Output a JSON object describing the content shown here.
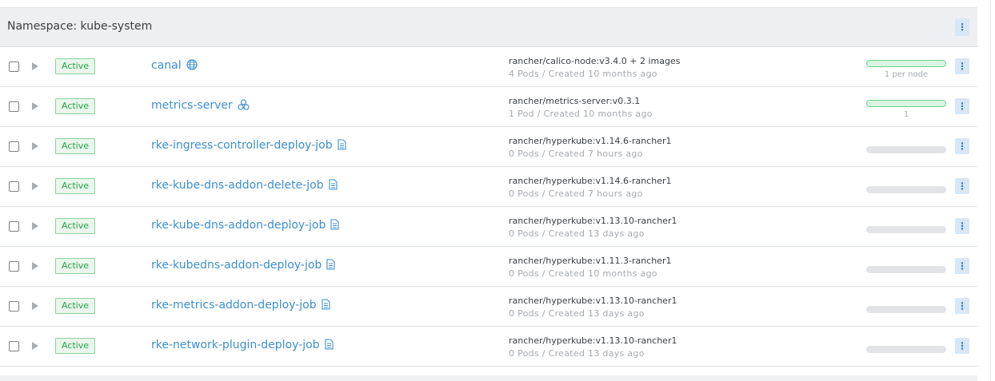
{
  "namespace": {
    "label": "Namespace: kube-system"
  },
  "colors": {
    "active_green": "#29a34a",
    "link_blue": "#3d8fd1",
    "kebab_bg": "#d8e7f6"
  },
  "rows": [
    {
      "state": "Active",
      "name": "canal",
      "icon": "globe-icon",
      "image": "rancher/calico-node:v3.4.0 + 2 images",
      "pods": "4 Pods",
      "created": "Created 10 months ago",
      "scale_type": "green",
      "scale_label": "1 per node"
    },
    {
      "state": "Active",
      "name": "metrics-server",
      "icon": "deployment-icon",
      "image": "rancher/metrics-server:v0.3.1",
      "pods": "1 Pod",
      "created": "Created 10 months ago",
      "scale_type": "green",
      "scale_label": "1"
    },
    {
      "state": "Active",
      "name": "rke-ingress-controller-deploy-job",
      "icon": "job-icon",
      "image": "rancher/hyperkube:v1.14.6-rancher1",
      "pods": "0 Pods",
      "created": "Created 7 hours ago",
      "scale_type": "grey",
      "scale_label": ""
    },
    {
      "state": "Active",
      "name": "rke-kube-dns-addon-delete-job",
      "icon": "job-icon",
      "image": "rancher/hyperkube:v1.14.6-rancher1",
      "pods": "0 Pods",
      "created": "Created 7 hours ago",
      "scale_type": "grey",
      "scale_label": ""
    },
    {
      "state": "Active",
      "name": "rke-kube-dns-addon-deploy-job",
      "icon": "job-icon",
      "image": "rancher/hyperkube:v1.13.10-rancher1",
      "pods": "0 Pods",
      "created": "Created 13 days ago",
      "scale_type": "grey",
      "scale_label": ""
    },
    {
      "state": "Active",
      "name": "rke-kubedns-addon-deploy-job",
      "icon": "job-icon",
      "image": "rancher/hyperkube:v1.11.3-rancher1",
      "pods": "0 Pods",
      "created": "Created 10 months ago",
      "scale_type": "grey",
      "scale_label": ""
    },
    {
      "state": "Active",
      "name": "rke-metrics-addon-deploy-job",
      "icon": "job-icon",
      "image": "rancher/hyperkube:v1.13.10-rancher1",
      "pods": "0 Pods",
      "created": "Created 13 days ago",
      "scale_type": "grey",
      "scale_label": ""
    },
    {
      "state": "Active",
      "name": "rke-network-plugin-deploy-job",
      "icon": "job-icon",
      "image": "rancher/hyperkube:v1.13.10-rancher1",
      "pods": "0 Pods",
      "created": "Created 13 days ago",
      "scale_type": "grey",
      "scale_label": ""
    }
  ],
  "sub_separator": " / ",
  "kebab_glyph": "⋮"
}
